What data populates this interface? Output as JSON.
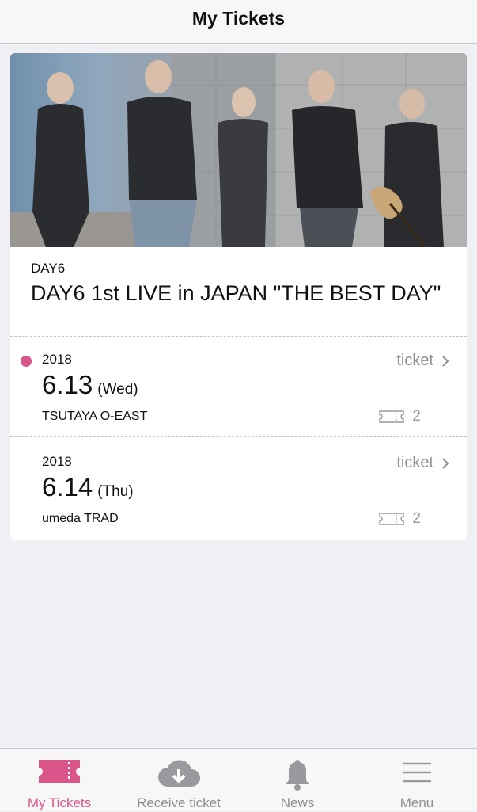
{
  "header": {
    "title": "My Tickets"
  },
  "event": {
    "artist": "DAY6",
    "title": "DAY6 1st LIVE in JAPAN \"THE BEST DAY\"",
    "image_alt": "band-photo"
  },
  "shows": [
    {
      "year": "2018",
      "date": "6.13",
      "weekday": "(Wed)",
      "venue": "TSUTAYA O-EAST",
      "link_label": "ticket",
      "ticket_count": "2",
      "highlighted": true
    },
    {
      "year": "2018",
      "date": "6.14",
      "weekday": "(Thu)",
      "venue": "umeda TRAD",
      "link_label": "ticket",
      "ticket_count": "2",
      "highlighted": false
    }
  ],
  "tabbar": {
    "items": [
      {
        "label": "My Tickets",
        "icon": "ticket-icon",
        "active": true
      },
      {
        "label": "Receive ticket",
        "icon": "cloud-download-icon",
        "active": false
      },
      {
        "label": "News",
        "icon": "bell-icon",
        "active": false
      },
      {
        "label": "Menu",
        "icon": "hamburger-menu-icon",
        "active": false
      }
    ]
  },
  "colors": {
    "accent": "#d9558a",
    "muted": "#8e8e93",
    "background": "#efeff4"
  }
}
